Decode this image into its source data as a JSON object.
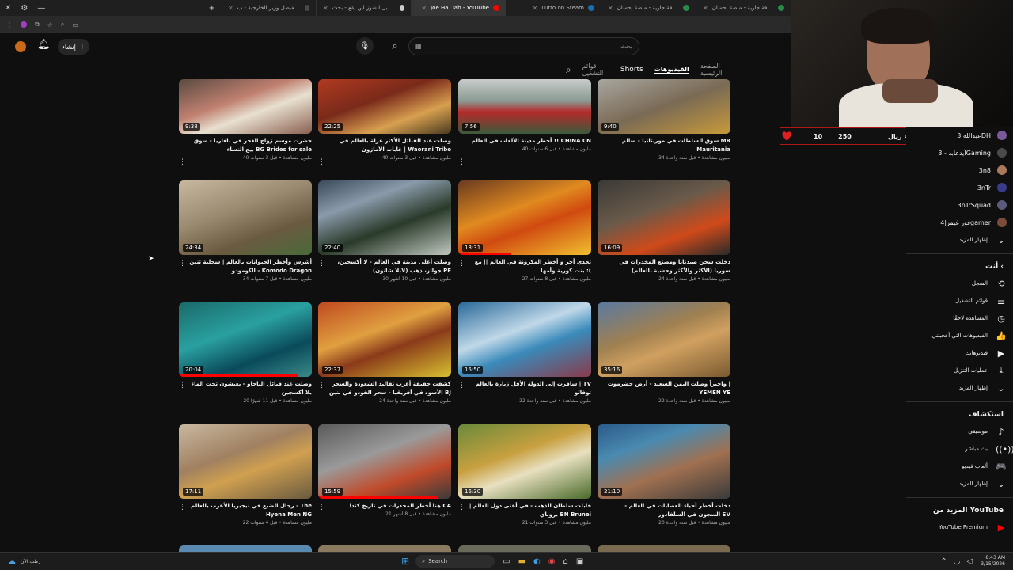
{
  "tabs": [
    {
      "label": "صدقة جارية - منصة إحسان",
      "active": false,
      "color": "#2a8a4a"
    },
    {
      "label": "صدقة جارية - منصة إحسان",
      "active": false,
      "color": "#2a8a4a"
    },
    {
      "label": "Lutto on Steam",
      "active": false,
      "color": "#1b6fa8"
    },
    {
      "label": "Joe HaTTab - YouTube",
      "active": true,
      "color": "#ff0000"
    },
    {
      "label": "جبل الشوز اين يقع - بحث Google",
      "active": false,
      "color": "#cccccc"
    },
    {
      "label": "سعود الفيصل وزير الخارجية - ب...",
      "active": false,
      "color": "#4a4a4a"
    }
  ],
  "header": {
    "create_label": "إنشاء",
    "search_placeholder": "بحث"
  },
  "channel_tabs": [
    "الصفحة الرئيسية",
    "الفيديوهات",
    "Shorts",
    "قوائم التشغيل"
  ],
  "videos": [
    {
      "title": "سوق السلطات في موريتانيا - سالم MR Mauritania",
      "meta": "34 مليون مشاهدة • قبل سنة واحدة",
      "dur": "9:40",
      "bg": "linear-gradient(160deg,#a8a6a0,#7a6a55 50%,#c79a3a)",
      "prog": 0
    },
    {
      "title": "أخطر مدينة الألعاب في العالم !! CHINA CN",
      "meta": "40 مليون مشاهدة • قبل 6 سنوات",
      "dur": "7:56",
      "bg": "linear-gradient(180deg,#c8ccca,#8a9a92 40%,#b52a2a 60%,#3c5a3c)",
      "prog": 0
    },
    {
      "title": "وصلت عند القبائل الأكثر عزلة بالعالم في غابات الأمازون | Waorani Tribe",
      "meta": "40 مليون مشاهدة • قبل 3 سنوات",
      "dur": "22:25",
      "bg": "linear-gradient(160deg,#b03a20,#7a2a1a 40%,#d8a050 70%,#4a3a20)",
      "prog": 0
    },
    {
      "title": "حضرت موسم زواج الغجر في بلغاريا - سوق بيع النساء BG Brides for sale",
      "meta": "40 مليون مشاهدة • قبل 3 سنوات",
      "dur": "9:38",
      "bg": "linear-gradient(160deg,#5a4a40,#c08070 40%,#e8e0d0 60%,#8a6050)",
      "prog": 0
    },
    {
      "title": "دخلت سجن صيدنايا ومصنع المخدرات في سوريا (الأكثر والأكثر وحشية بالعالم)",
      "meta": "24 مليون مشاهدة • قبل سنة واحدة",
      "dur": "16:09",
      "bg": "linear-gradient(160deg,#3a3a38,#6a5a4a 40%,#d04a1a 70%,#2a2a2a)",
      "prog": 0
    },
    {
      "title": "تحدي أحر و أخطر المكرونة في العالم || مع بنت كورية وأمها :(",
      "meta": "27 مليون مشاهدة • قبل 8 سنوات",
      "dur": "13:31",
      "bg": "linear-gradient(160deg,#6a3a20,#e08a20 40%,#d04a10 60%,#f0c030)",
      "prog": 0.4
    },
    {
      "title": "وصلت أعلى مدينة في العالم - لا أكسجين، جوائز، ذهب (لابلا شانون) PE",
      "meta": "30 مليون مشاهدة • قبل 10 أشهر",
      "dur": "22:40",
      "bg": "linear-gradient(160deg,#3a4a5a,#8a9aaa 30%,#2a3a2a 60%,#c0c8c0)",
      "prog": 0
    },
    {
      "title": "أشرس وأخطر الحيوانات بالعالم | سحلية تنين الكومودو - Komodo Dragon",
      "meta": "34 مليون مشاهدة • قبل 7 سنوات",
      "dur": "24:34",
      "bg": "linear-gradient(160deg,#c8b8a0,#9a8a70 40%,#6a5a40 70%,#4a6a3a)",
      "prog": 0
    },
    {
      "title": "واخيراً وصلت اليمن السعيد - أرض حضرموت | YEMEN YE",
      "meta": "22 مليون مشاهدة • قبل سنة واحدة",
      "dur": "35:16",
      "bg": "linear-gradient(160deg,#5a7aa0,#a08050 40%,#d0a060 60%,#7a5a30)",
      "prog": 0
    },
    {
      "title": "سافرت إلى الدولة الأقل زيارة بالعالم | TV توفالو",
      "meta": "22 مليون مشاهدة • قبل سنة واحدة",
      "dur": "15:50",
      "bg": "linear-gradient(160deg,#2a6a9a,#c0d8e8 40%,#3a8aba 60%,#8a3a4a)",
      "prog": 0
    },
    {
      "title": "كشفت حقيقة أغرب تقاليد الشعوذة والسحر الأسود في أفريقيا - سحر الفودو في بنين BJ",
      "meta": "24 مليون مشاهدة • قبل سنة واحدة",
      "dur": "22:37",
      "bg": "linear-gradient(160deg,#c04a20,#e0a040 40%,#8a3a1a 60%,#d8c030)",
      "prog": 0
    },
    {
      "title": "وصلت عند قبائل الباجاو - يعيشون تحت الماء بلا أكسجين",
      "meta": "20 مليون مشاهدة • قبل 11 شهرًا",
      "dur": "20:04",
      "bg": "linear-gradient(160deg,#1a6a6a,#2aa0a0 40%,#0a4a5a 70%,#3a8a8a)",
      "prog": 0.9
    },
    {
      "title": "دخلت أخطر أحياء العصابات في العالم - السجون في السلفادور SV",
      "meta": "20 مليون مشاهدة • قبل سنة واحدة",
      "dur": "21:10",
      "bg": "linear-gradient(160deg,#2a5a8a,#4a8ab0 30%,#a07050 60%,#3a3a3a)",
      "prog": 0
    },
    {
      "title": "قابلت سلطان الذهب - في أغنى دول العالم | بروناي BN Brunei",
      "meta": "21 مليون مشاهدة • قبل 3 سنوات",
      "dur": "16:30",
      "bg": "linear-gradient(160deg,#6a8a3a,#c8a040 40%,#e8e0c0 60%,#4a6a2a)",
      "prog": 0
    },
    {
      "title": "هنا أخطر المخدرات في تاريخ كندا CA",
      "meta": "21 مليون مشاهدة • قبل 8 أشهر",
      "dur": "15:59",
      "bg": "linear-gradient(160deg,#5a5a5a,#9a9a9a 40%,#c04a2a 70%,#3a3a3a)",
      "prog": 0.9
    },
    {
      "title": "رجال الضبع في نيجيريا الأغرب بالعالم - The Hyena Men NG",
      "meta": "22 مليون مشاهدة • قبل 4 سنوات",
      "dur": "17:11",
      "bg": "linear-gradient(160deg,#c8b8a0,#a08060 40%,#d0a050 60%,#6a5a40)",
      "prog": 0
    }
  ],
  "subscriptions": [
    {
      "label": "عبدالله 3DH",
      "color": "#7a5a9a"
    },
    {
      "label": "آيدعابد - 3Gaming",
      "color": "#4a4a4a"
    },
    {
      "label": "3n8",
      "color": "#aa7a5a"
    },
    {
      "label": "3nTr",
      "color": "#3a3a8a"
    },
    {
      "label": "3nTrSquad",
      "color": "#5a5a7a"
    },
    {
      "label": "فور غيمر|4gamer",
      "color": "#7a4a3a"
    }
  ],
  "show_more": "إظهار المزيد",
  "you_section": {
    "title": "أنت",
    "items": [
      {
        "label": "السجل",
        "icon": "history-icon",
        "glyph": "⟲"
      },
      {
        "label": "قوائم التشغيل",
        "icon": "playlist-icon",
        "glyph": "☰"
      },
      {
        "label": "المشاهدة لاحقًا",
        "icon": "clock-icon",
        "glyph": "◷"
      },
      {
        "label": "الفيديوهات التي أعجبتني",
        "icon": "thumb-up-icon",
        "glyph": "👍"
      },
      {
        "label": "فيديوهاتك",
        "icon": "video-icon",
        "glyph": "▶"
      },
      {
        "label": "عمليات التنزيل",
        "icon": "download-icon",
        "glyph": "⤓"
      },
      {
        "label": "إظهار المزيد",
        "icon": "chevron-down-icon",
        "glyph": "⌄"
      }
    ]
  },
  "explore_section": {
    "title": "استكشاف",
    "items": [
      {
        "label": "موسيقى",
        "icon": "music-icon",
        "glyph": "♪"
      },
      {
        "label": "بث مباشر",
        "icon": "live-icon",
        "glyph": "((•))"
      },
      {
        "label": "ألعاب فيديو",
        "icon": "gaming-icon",
        "glyph": "🎮"
      },
      {
        "label": "إظهار المزيد",
        "icon": "chevron-down-icon",
        "glyph": "⌄"
      }
    ]
  },
  "more_section": {
    "title": "المزيد من YouTube",
    "items": [
      {
        "label": "YouTube Premium",
        "icon": "youtube-premium-icon",
        "glyph": "▶"
      }
    ]
  },
  "stream_overlay": {
    "text": "متابعتك بصدقة | كل فولو = ريال",
    "count_a": "10",
    "count_b": "250"
  },
  "taskbar": {
    "search": "Search",
    "time": "8:43 AM",
    "date": "3/15/2026",
    "weather": "رطب الآن"
  }
}
